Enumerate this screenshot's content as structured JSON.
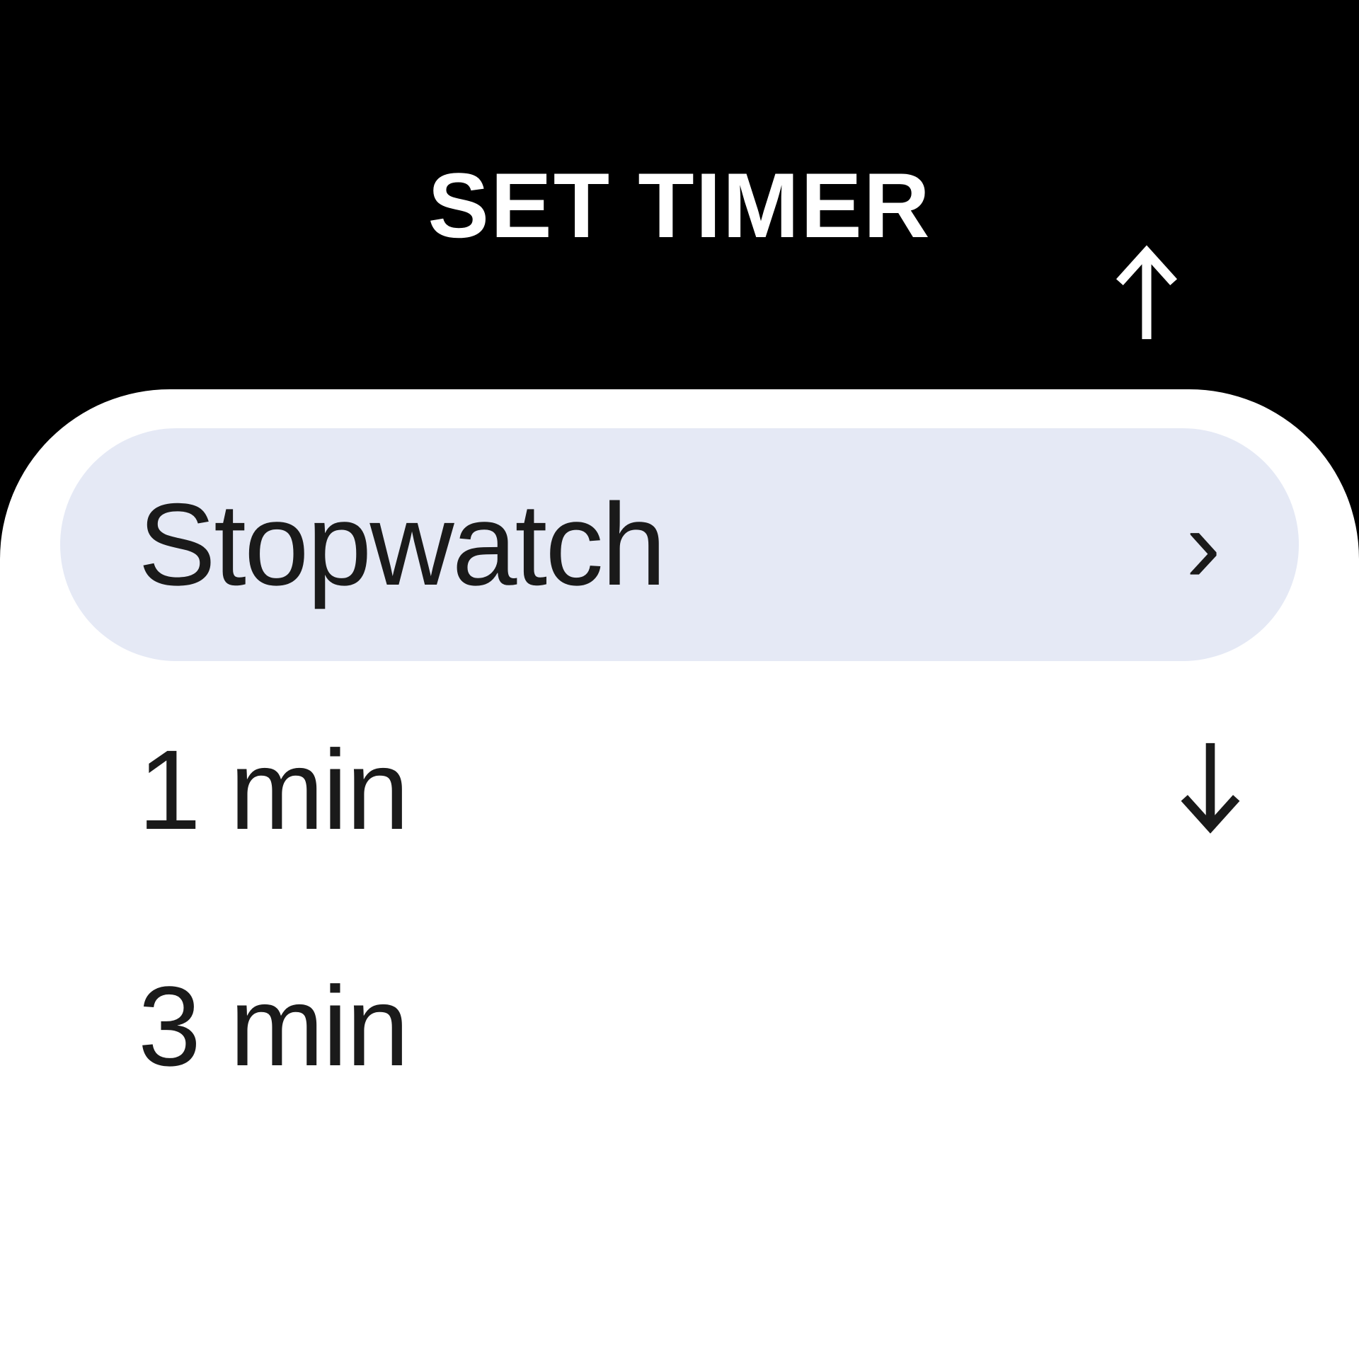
{
  "header": {
    "title": "SET TIMER"
  },
  "selected": {
    "label": "Stopwatch"
  },
  "items": [
    {
      "label": "1 min"
    },
    {
      "label": "3 min"
    }
  ]
}
